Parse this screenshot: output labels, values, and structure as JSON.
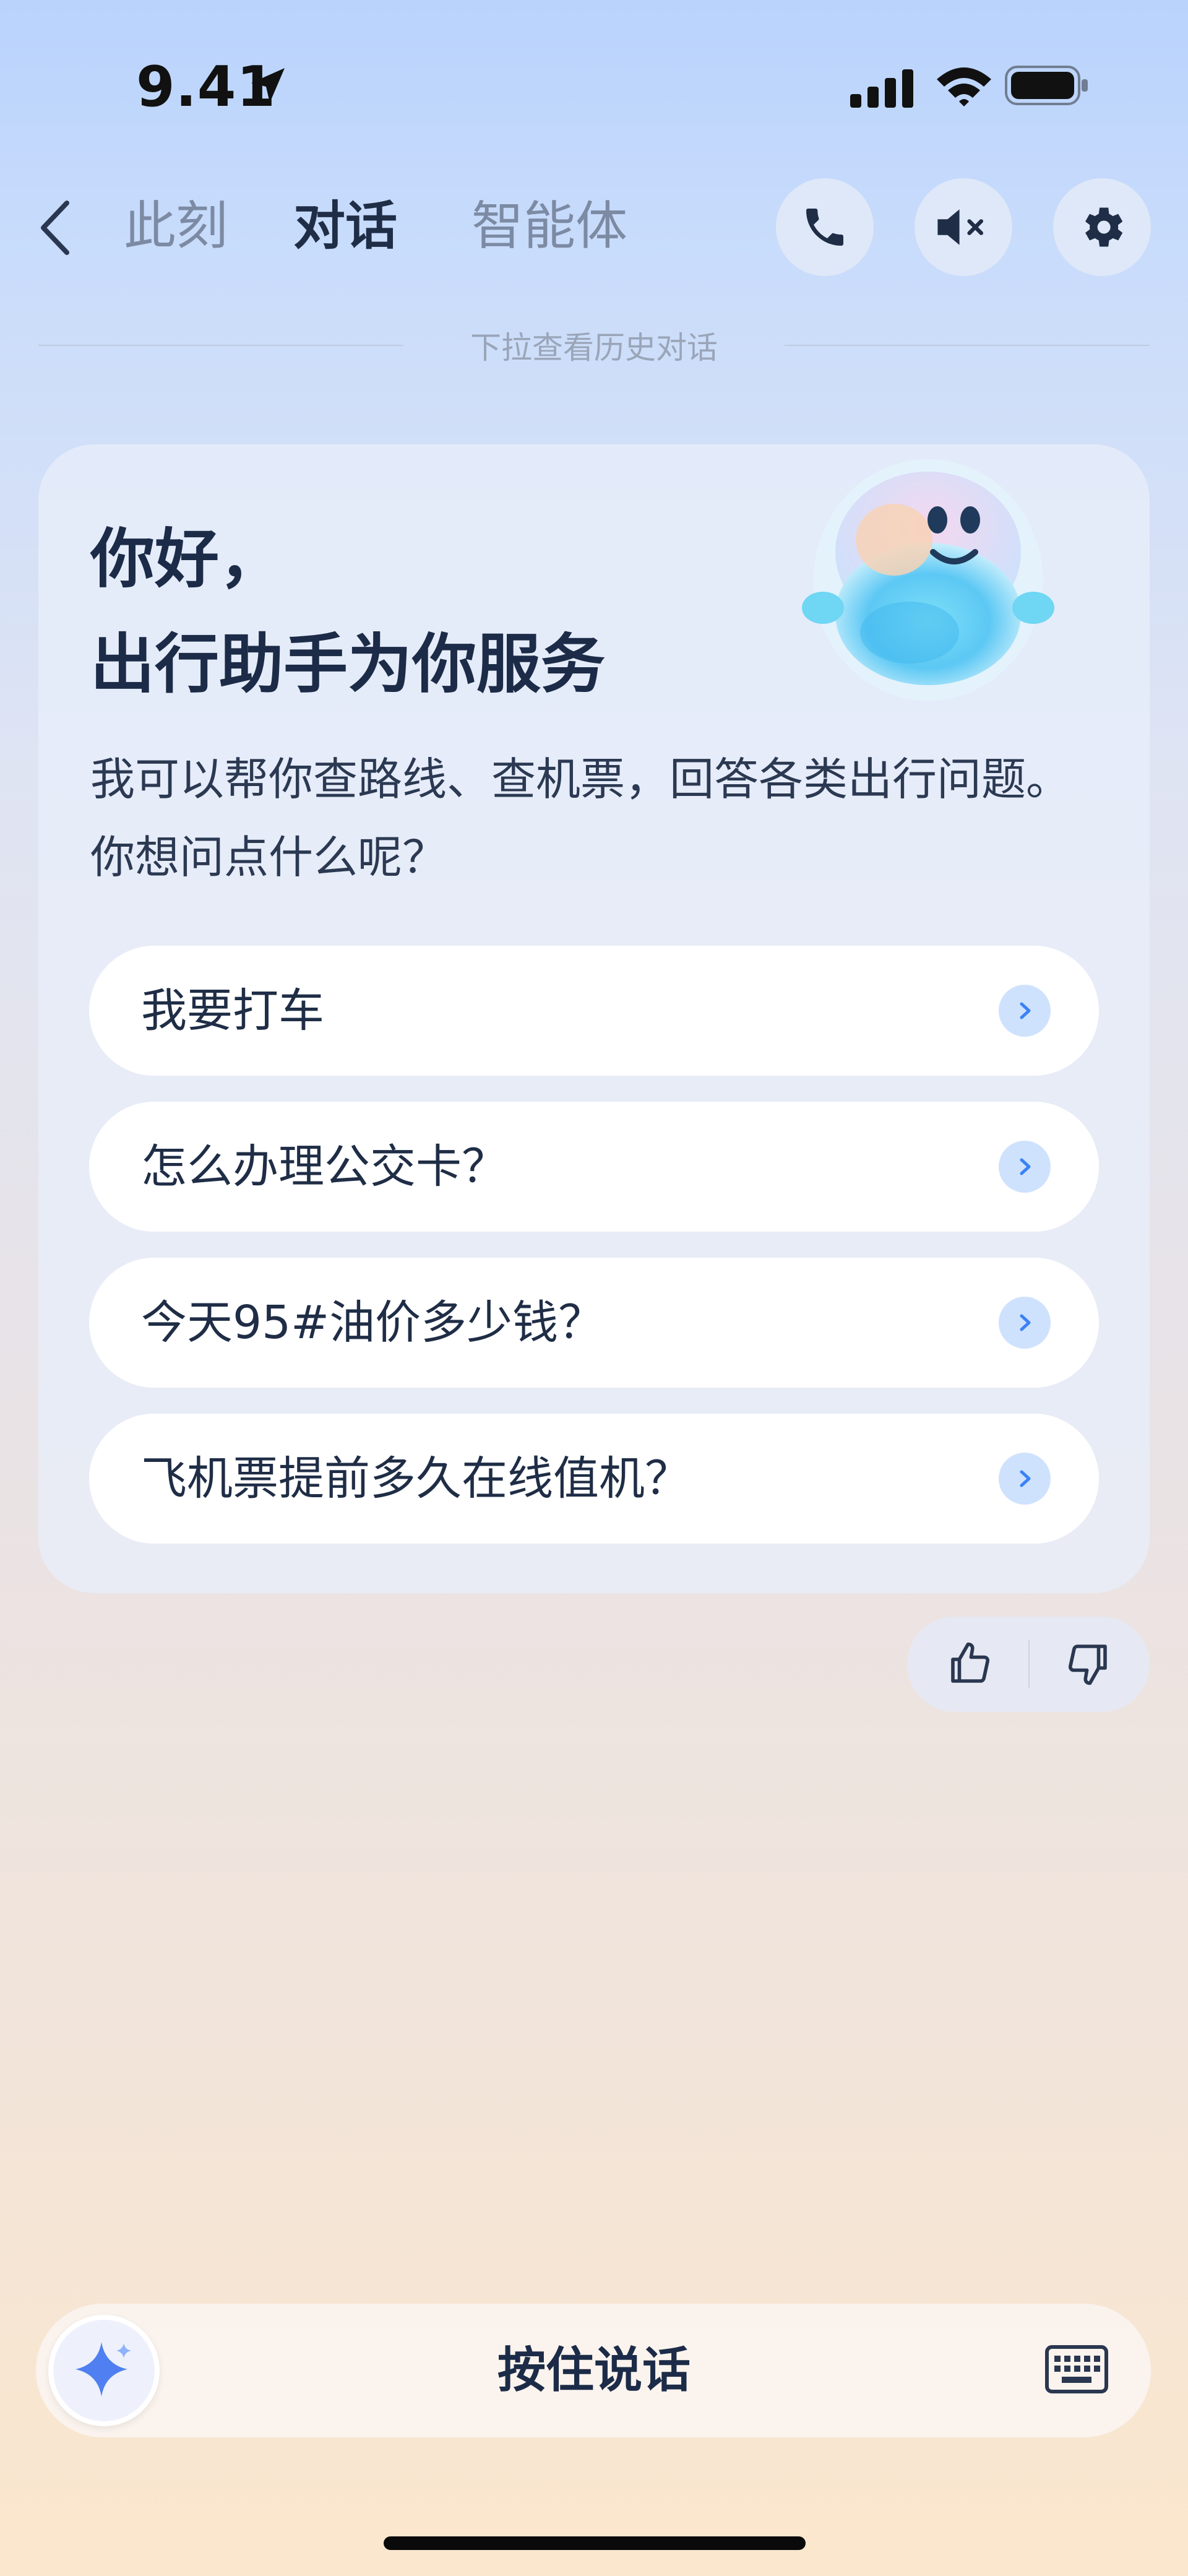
{
  "status_bar": {
    "time": "9.41"
  },
  "nav": {
    "tabs": [
      {
        "label": "此刻"
      },
      {
        "label": "对话"
      },
      {
        "label": "智能体"
      }
    ],
    "active_tab": "对话"
  },
  "history_hint": "下拉查看历史对话",
  "card": {
    "greeting_line1": "你好，",
    "greeting_line2": "出行助手为你服务",
    "intro": "我可以帮你查路线、查机票，回答各类出行问题。你想问点什么呢？",
    "suggestions": [
      {
        "label": "我要打车"
      },
      {
        "label": "怎么办理公交卡？"
      },
      {
        "label": "今天95#油价多少钱？"
      },
      {
        "label": "飞机票提前多久在线值机？"
      }
    ]
  },
  "bottom_bar": {
    "hold_to_talk": "按住说话"
  },
  "icons": {
    "back": "chevron-left-icon",
    "phone": "phone-icon",
    "mute": "speaker-muted-icon",
    "settings": "gear-icon",
    "thumbs_up": "thumbs-up-icon",
    "thumbs_down": "thumbs-down-icon",
    "ai": "sparkle-icon",
    "keyboard": "keyboard-icon"
  },
  "colors": {
    "accent": "#1c2b47",
    "chevron_bg": "#cfe2fd",
    "chevron": "#3b82f6",
    "sparkle": "#4f7ff0"
  }
}
